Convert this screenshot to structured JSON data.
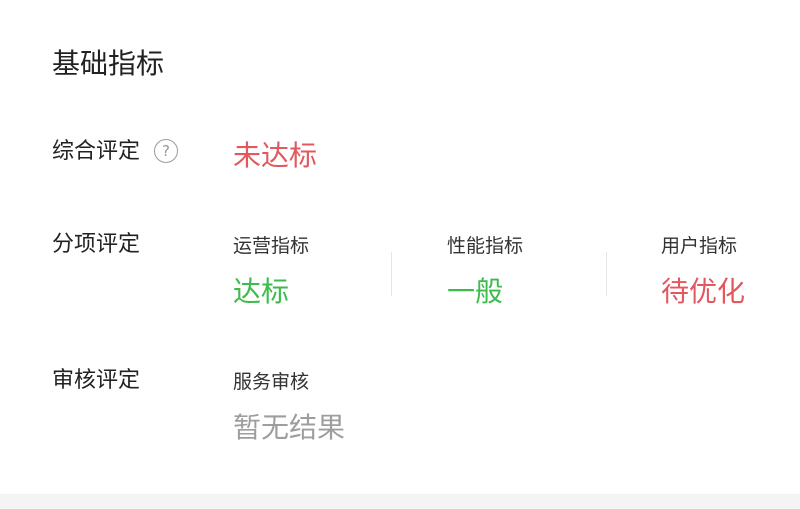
{
  "section": {
    "title": "基础指标"
  },
  "overall": {
    "label": "综合评定",
    "help_icon": "?",
    "value": "未达标",
    "value_color": "#e2585e"
  },
  "itemized": {
    "label": "分项评定",
    "metrics": [
      {
        "label": "运营指标",
        "value": "达标",
        "value_color": "#3dbb4c"
      },
      {
        "label": "性能指标",
        "value": "一般",
        "value_color": "#3dbb4c"
      },
      {
        "label": "用户指标",
        "value": "待优化",
        "value_color": "#e2585e"
      }
    ]
  },
  "review": {
    "label": "审核评定",
    "item_label": "服务审核",
    "item_value": "暂无结果",
    "item_value_color": "#9e9e9e"
  }
}
